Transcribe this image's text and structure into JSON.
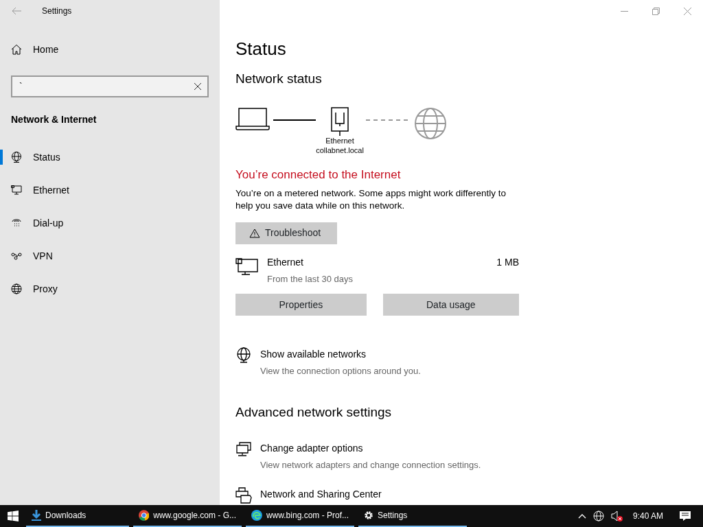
{
  "window": {
    "title": "Settings"
  },
  "sidebar": {
    "home": "Home",
    "search": {
      "value": "`"
    },
    "section": "Network & Internet",
    "items": [
      {
        "label": "Status",
        "selected": true
      },
      {
        "label": "Ethernet",
        "selected": false
      },
      {
        "label": "Dial-up",
        "selected": false
      },
      {
        "label": "VPN",
        "selected": false
      },
      {
        "label": "Proxy",
        "selected": false
      }
    ]
  },
  "main": {
    "title": "Status",
    "subtitle": "Network status",
    "diagram": {
      "adapter": "Ethernet",
      "domain": "collabnet.local"
    },
    "connection": "You’re connected to the Internet",
    "description": "You’re on a metered network. Some apps might work differently to help you save data while on this network.",
    "troubleshoot": "Troubleshoot",
    "usage": {
      "name": "Ethernet",
      "period": "From the last 30 days",
      "amount": "1 MB"
    },
    "buttons": [
      "Properties",
      "Data usage"
    ],
    "links": [
      {
        "title": "Show available networks",
        "description": "View the connection options around you."
      }
    ],
    "advanced_heading": "Advanced network settings",
    "advanced": [
      {
        "title": "Change adapter options",
        "description": "View network adapters and change connection settings."
      },
      {
        "title": "Network and Sharing Center"
      }
    ]
  },
  "taskbar": {
    "apps": [
      {
        "label": "Downloads",
        "running": true
      },
      {
        "label": "www.google.com - G...",
        "running": true
      },
      {
        "label": "www.bing.com - Prof...",
        "running": true
      },
      {
        "label": "Settings",
        "running": true
      }
    ],
    "time": "9:40 AM"
  }
}
